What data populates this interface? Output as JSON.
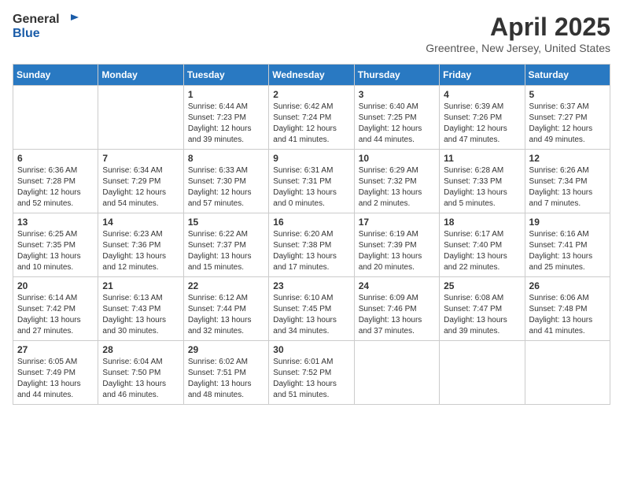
{
  "header": {
    "logo_general": "General",
    "logo_blue": "Blue",
    "month": "April 2025",
    "location": "Greentree, New Jersey, United States"
  },
  "weekdays": [
    "Sunday",
    "Monday",
    "Tuesday",
    "Wednesday",
    "Thursday",
    "Friday",
    "Saturday"
  ],
  "weeks": [
    [
      {
        "day": "",
        "info": ""
      },
      {
        "day": "",
        "info": ""
      },
      {
        "day": "1",
        "info": "Sunrise: 6:44 AM\nSunset: 7:23 PM\nDaylight: 12 hours and 39 minutes."
      },
      {
        "day": "2",
        "info": "Sunrise: 6:42 AM\nSunset: 7:24 PM\nDaylight: 12 hours and 41 minutes."
      },
      {
        "day": "3",
        "info": "Sunrise: 6:40 AM\nSunset: 7:25 PM\nDaylight: 12 hours and 44 minutes."
      },
      {
        "day": "4",
        "info": "Sunrise: 6:39 AM\nSunset: 7:26 PM\nDaylight: 12 hours and 47 minutes."
      },
      {
        "day": "5",
        "info": "Sunrise: 6:37 AM\nSunset: 7:27 PM\nDaylight: 12 hours and 49 minutes."
      }
    ],
    [
      {
        "day": "6",
        "info": "Sunrise: 6:36 AM\nSunset: 7:28 PM\nDaylight: 12 hours and 52 minutes."
      },
      {
        "day": "7",
        "info": "Sunrise: 6:34 AM\nSunset: 7:29 PM\nDaylight: 12 hours and 54 minutes."
      },
      {
        "day": "8",
        "info": "Sunrise: 6:33 AM\nSunset: 7:30 PM\nDaylight: 12 hours and 57 minutes."
      },
      {
        "day": "9",
        "info": "Sunrise: 6:31 AM\nSunset: 7:31 PM\nDaylight: 13 hours and 0 minutes."
      },
      {
        "day": "10",
        "info": "Sunrise: 6:29 AM\nSunset: 7:32 PM\nDaylight: 13 hours and 2 minutes."
      },
      {
        "day": "11",
        "info": "Sunrise: 6:28 AM\nSunset: 7:33 PM\nDaylight: 13 hours and 5 minutes."
      },
      {
        "day": "12",
        "info": "Sunrise: 6:26 AM\nSunset: 7:34 PM\nDaylight: 13 hours and 7 minutes."
      }
    ],
    [
      {
        "day": "13",
        "info": "Sunrise: 6:25 AM\nSunset: 7:35 PM\nDaylight: 13 hours and 10 minutes."
      },
      {
        "day": "14",
        "info": "Sunrise: 6:23 AM\nSunset: 7:36 PM\nDaylight: 13 hours and 12 minutes."
      },
      {
        "day": "15",
        "info": "Sunrise: 6:22 AM\nSunset: 7:37 PM\nDaylight: 13 hours and 15 minutes."
      },
      {
        "day": "16",
        "info": "Sunrise: 6:20 AM\nSunset: 7:38 PM\nDaylight: 13 hours and 17 minutes."
      },
      {
        "day": "17",
        "info": "Sunrise: 6:19 AM\nSunset: 7:39 PM\nDaylight: 13 hours and 20 minutes."
      },
      {
        "day": "18",
        "info": "Sunrise: 6:17 AM\nSunset: 7:40 PM\nDaylight: 13 hours and 22 minutes."
      },
      {
        "day": "19",
        "info": "Sunrise: 6:16 AM\nSunset: 7:41 PM\nDaylight: 13 hours and 25 minutes."
      }
    ],
    [
      {
        "day": "20",
        "info": "Sunrise: 6:14 AM\nSunset: 7:42 PM\nDaylight: 13 hours and 27 minutes."
      },
      {
        "day": "21",
        "info": "Sunrise: 6:13 AM\nSunset: 7:43 PM\nDaylight: 13 hours and 30 minutes."
      },
      {
        "day": "22",
        "info": "Sunrise: 6:12 AM\nSunset: 7:44 PM\nDaylight: 13 hours and 32 minutes."
      },
      {
        "day": "23",
        "info": "Sunrise: 6:10 AM\nSunset: 7:45 PM\nDaylight: 13 hours and 34 minutes."
      },
      {
        "day": "24",
        "info": "Sunrise: 6:09 AM\nSunset: 7:46 PM\nDaylight: 13 hours and 37 minutes."
      },
      {
        "day": "25",
        "info": "Sunrise: 6:08 AM\nSunset: 7:47 PM\nDaylight: 13 hours and 39 minutes."
      },
      {
        "day": "26",
        "info": "Sunrise: 6:06 AM\nSunset: 7:48 PM\nDaylight: 13 hours and 41 minutes."
      }
    ],
    [
      {
        "day": "27",
        "info": "Sunrise: 6:05 AM\nSunset: 7:49 PM\nDaylight: 13 hours and 44 minutes."
      },
      {
        "day": "28",
        "info": "Sunrise: 6:04 AM\nSunset: 7:50 PM\nDaylight: 13 hours and 46 minutes."
      },
      {
        "day": "29",
        "info": "Sunrise: 6:02 AM\nSunset: 7:51 PM\nDaylight: 13 hours and 48 minutes."
      },
      {
        "day": "30",
        "info": "Sunrise: 6:01 AM\nSunset: 7:52 PM\nDaylight: 13 hours and 51 minutes."
      },
      {
        "day": "",
        "info": ""
      },
      {
        "day": "",
        "info": ""
      },
      {
        "day": "",
        "info": ""
      }
    ]
  ]
}
